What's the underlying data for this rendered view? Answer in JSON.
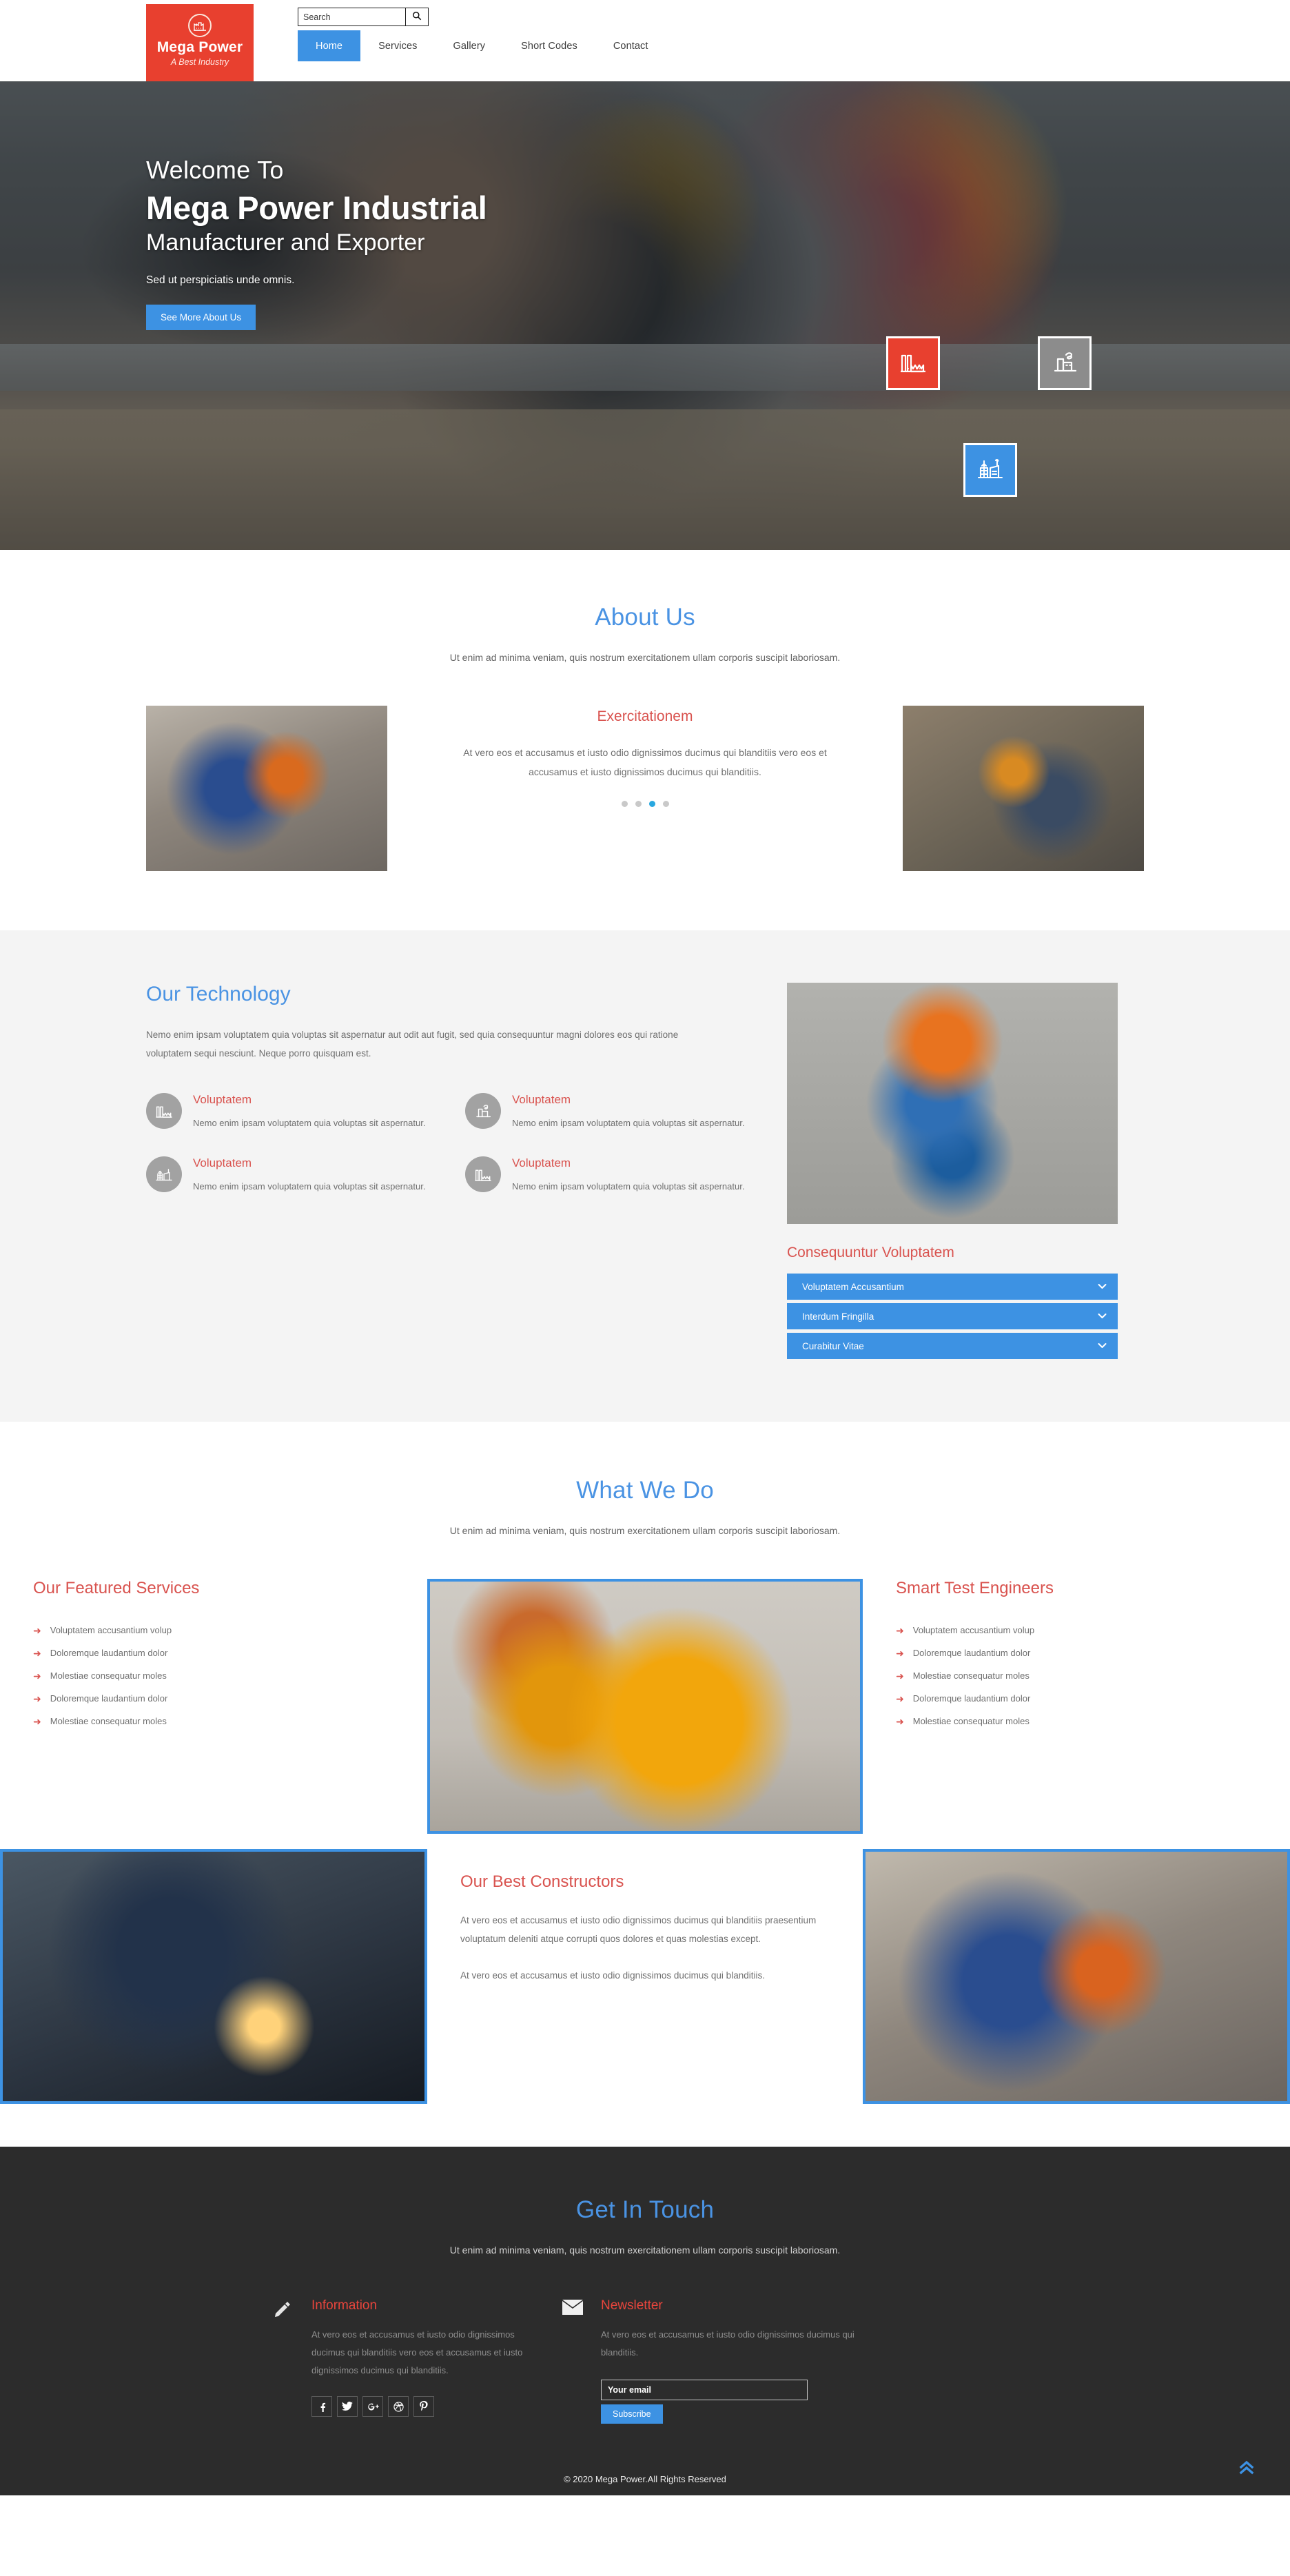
{
  "brand": {
    "name": "Mega Power",
    "tagline": "A Best Industry",
    "logo_icon": "factory-icon",
    "accent_red": "#e8402f",
    "accent_blue": "#3d92e3"
  },
  "search": {
    "placeholder": "Search",
    "value": "",
    "button_icon": "search-icon"
  },
  "nav": {
    "items": [
      {
        "label": "Home",
        "active": true
      },
      {
        "label": "Services",
        "active": false
      },
      {
        "label": "Gallery",
        "active": false
      },
      {
        "label": "Short Codes",
        "active": false
      },
      {
        "label": "Contact",
        "active": false
      }
    ]
  },
  "hero": {
    "welcome": "Welcome To",
    "title": "Mega Power Industrial",
    "subtitle": "Manufacturer and Exporter",
    "tagline": "Sed ut perspiciatis unde omnis.",
    "cta_label": "See More About Us",
    "badges": [
      {
        "icon": "factory-chart-icon",
        "color": "#e8402f"
      },
      {
        "icon": "factory-smoke-icon",
        "color": "#8c8c8c"
      },
      {
        "icon": "factory-tower-icon",
        "color": "#3d92e3"
      }
    ]
  },
  "about": {
    "title": "About Us",
    "subtitle": "Ut enim ad minima veniam, quis nostrum exercitationem ullam corporis suscipit laboriosam.",
    "slide_title": "Exercitationem",
    "slide_text": "At vero eos et accusamus et iusto odio dignissimos ducimus qui blanditiis vero eos et accusamus et iusto dignissimos ducimus qui blanditiis.",
    "dots_count": 4,
    "active_dot": 3,
    "left_image_alt": "workshop-machine-photo",
    "right_image_alt": "factory-floor-photo"
  },
  "technology": {
    "title": "Our Technology",
    "paragraph": "Nemo enim ipsam voluptatem quia voluptas sit aspernatur aut odit aut fugit, sed quia consequuntur magni dolores eos qui ratione voluptatem sequi nesciunt. Neque porro quisquam est.",
    "features": [
      {
        "icon": "factory-chart-icon",
        "title": "Voluptatem",
        "text": "Nemo enim ipsam voluptatem quia voluptas sit aspernatur."
      },
      {
        "icon": "factory-smoke-icon",
        "title": "Voluptatem",
        "text": "Nemo enim ipsam voluptatem quia voluptas sit aspernatur."
      },
      {
        "icon": "factory-tower-icon",
        "title": "Voluptatem",
        "text": "Nemo enim ipsam voluptatem quia voluptas sit aspernatur."
      },
      {
        "icon": "factory-chart-icon",
        "title": "Voluptatem",
        "text": "Nemo enim ipsam voluptatem quia voluptas sit aspernatur."
      }
    ],
    "image_alt": "concrete-saw-worker-photo",
    "accordion_title": "Consequuntur Voluptatem",
    "accordion": [
      {
        "label": "Voluptatem Accusantium",
        "icon": "chevron-down-icon"
      },
      {
        "label": "Interdum Fringilla",
        "icon": "chevron-down-icon"
      },
      {
        "label": "Curabitur Vitae",
        "icon": "chevron-down-icon"
      }
    ]
  },
  "what_we_do": {
    "title": "What We Do",
    "subtitle": "Ut enim ad minima veniam, quis nostrum exercitationem ullam corporis suscipit laboriosam.",
    "featured_services": {
      "title": "Our Featured Services",
      "items": [
        "Voluptatem accusantium volup",
        "Doloremque laudantium dolor",
        "Molestiae consequatur moles",
        "Doloremque laudantium dolor",
        "Molestiae consequatur moles"
      ]
    },
    "smart_engineers": {
      "title": "Smart Test Engineers",
      "items": [
        "Voluptatem accusantium volup",
        "Doloremque laudantium dolor",
        "Molestiae consequatur moles",
        "Doloremque laudantium dolor",
        "Molestiae consequatur moles"
      ]
    },
    "center_image_alt": "forklift-warehouse-photo",
    "left_image_alt": "welder-sparks-photo",
    "right_image_alt": "workshop-machine-photo",
    "constructors": {
      "title": "Our Best Constructors",
      "paragraph1": "At vero eos et accusamus et iusto odio dignissimos ducimus qui blanditiis praesentium voluptatum deleniti atque corrupti quos dolores et quas molestias except.",
      "paragraph2": "At vero eos et accusamus et iusto odio dignissimos ducimus qui blanditiis."
    }
  },
  "footer": {
    "title": "Get In Touch",
    "subtitle": "Ut enim ad minima veniam, quis nostrum exercitationem ullam corporis suscipit laboriosam.",
    "information": {
      "icon": "pencil-icon",
      "title": "Information",
      "text": "At vero eos et accusamus et iusto odio dignissimos ducimus qui blanditiis vero eos et accusamus et iusto dignissimos ducimus qui blanditiis.",
      "social": [
        {
          "name": "facebook-icon",
          "glyph": "f"
        },
        {
          "name": "twitter-icon",
          "glyph": "t"
        },
        {
          "name": "google-plus-icon",
          "glyph": "g"
        },
        {
          "name": "dribbble-icon",
          "glyph": "d"
        },
        {
          "name": "pinterest-icon",
          "glyph": "p"
        }
      ]
    },
    "newsletter": {
      "icon": "envelope-icon",
      "title": "Newsletter",
      "text": "At vero eos et accusamus et iusto odio dignissimos ducimus qui blanditiis.",
      "input_placeholder": "Your email",
      "input_value": "",
      "button_label": "Subscribe"
    },
    "copyright": "© 2020 Mega Power.All Rights Reserved",
    "back_to_top_icon": "double-chevron-up-icon"
  }
}
